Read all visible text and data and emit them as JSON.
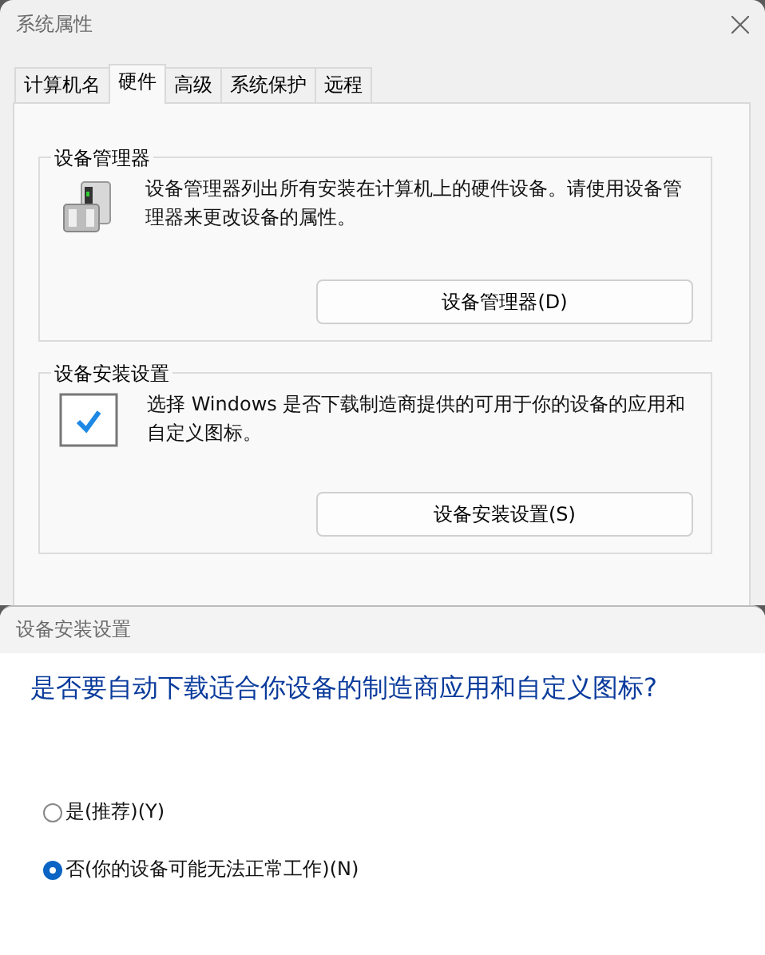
{
  "window": {
    "title": "系统属性"
  },
  "tabs": [
    {
      "label": "计算机名",
      "selected": false
    },
    {
      "label": "硬件",
      "selected": true
    },
    {
      "label": "高级",
      "selected": false
    },
    {
      "label": "系统保护",
      "selected": false
    },
    {
      "label": "远程",
      "selected": false
    }
  ],
  "groups": [
    {
      "kind": "device_manager",
      "title": "设备管理器",
      "description": "设备管理器列出所有安装在计算机上的硬件设备。请使用设备管理器来更改设备的属性。",
      "button": "设备管理器(D)"
    },
    {
      "kind": "install_settings",
      "title": "设备安装设置",
      "description": "选择 Windows 是否下载制造商提供的可用于你的设备的应用和自定义图标。",
      "button": "设备安装设置(S)"
    }
  ],
  "dialog": {
    "title": "设备安装设置",
    "question": "是否要自动下载适合你设备的制造商应用和自定义图标?",
    "options": [
      {
        "label": "是(推荐)(Y)",
        "selected": false
      },
      {
        "label": "否(你的设备可能无法正常工作)(N)",
        "selected": true
      }
    ]
  }
}
